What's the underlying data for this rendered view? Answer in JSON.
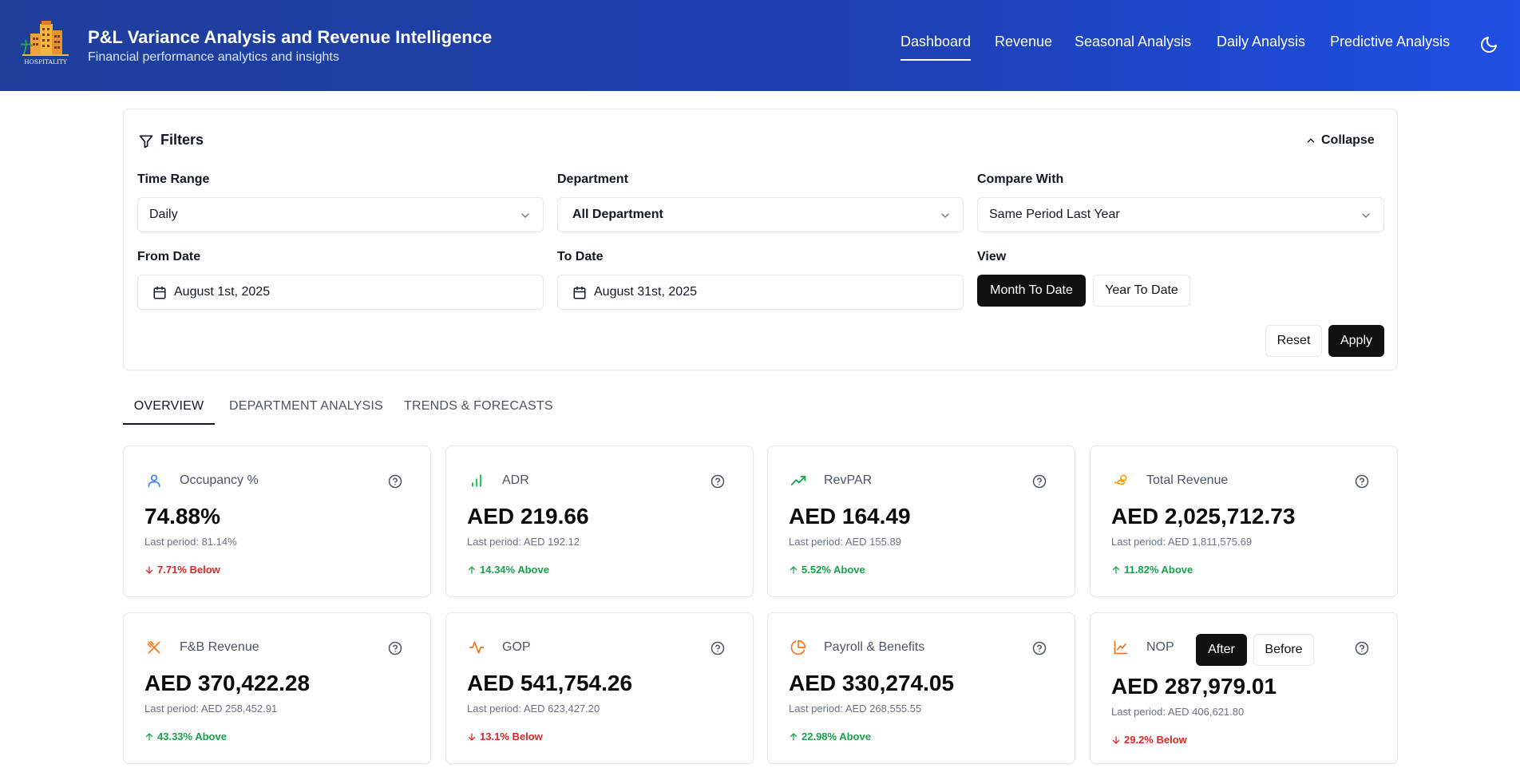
{
  "header": {
    "logo_text": "HOSPITALITY",
    "title": "P&L Variance Analysis and Revenue Intelligence",
    "subtitle": "Financial performance analytics and insights",
    "nav": [
      "Dashboard",
      "Revenue",
      "Seasonal Analysis",
      "Daily Analysis",
      "Predictive Analysis"
    ],
    "active_nav": "Dashboard",
    "theme_icon": "moon-icon"
  },
  "filters": {
    "title": "Filters",
    "collapse_label": "Collapse",
    "time_range_label": "Time Range",
    "time_range_value": "Daily",
    "department_label": "Department",
    "department_value": "All Department",
    "compare_label": "Compare With",
    "compare_value": "Same Period Last Year",
    "from_label": "From Date",
    "from_value": "August 1st, 2025",
    "to_label": "To Date",
    "to_value": "August 31st, 2025",
    "view_label": "View",
    "view_options": [
      "Month To Date",
      "Year To Date"
    ],
    "view_selected": "Month To Date",
    "reset_label": "Reset",
    "apply_label": "Apply"
  },
  "tabs": [
    "OVERVIEW",
    "DEPARTMENT ANALYSIS",
    "TRENDS & FORECASTS"
  ],
  "active_tab": "OVERVIEW",
  "colors": {
    "up": "#16a34a",
    "down": "#dc2626",
    "accent_orange": "#f97316",
    "accent_blue": "#3b82f6"
  },
  "kpis": [
    {
      "label": "Occupancy %",
      "value": "74.88%",
      "last": "Last period: 81.14%",
      "change": "7.71% Below",
      "direction": "down",
      "icon": "user-icon"
    },
    {
      "label": "ADR",
      "value": "AED 219.66",
      "last": "Last period: AED 192.12",
      "change": "14.34% Above",
      "direction": "up",
      "icon": "bar-chart-icon"
    },
    {
      "label": "RevPAR",
      "value": "AED 164.49",
      "last": "Last period: AED 155.89",
      "change": "5.52% Above",
      "direction": "up",
      "icon": "trending-up-icon"
    },
    {
      "label": "Total Revenue",
      "value": "AED 2,025,712.73",
      "last": "Last period: AED 1,811,575.69",
      "change": "11.82% Above",
      "direction": "up",
      "icon": "hand-coins-icon"
    },
    {
      "label": "F&B Revenue",
      "value": "AED 370,422.28",
      "last": "Last period: AED 258,452.91",
      "change": "43.33% Above",
      "direction": "up",
      "icon": "utensils-crossed-icon"
    },
    {
      "label": "GOP",
      "value": "AED 541,754.26",
      "last": "Last period: AED 623,427.20",
      "change": "13.1% Below",
      "direction": "down",
      "icon": "activity-icon"
    },
    {
      "label": "Payroll & Benefits",
      "value": "AED 330,274.05",
      "last": "Last period: AED 268,555.55",
      "change": "22.98% Above",
      "direction": "up",
      "icon": "pie-chart-icon"
    },
    {
      "label": "NOP",
      "value": "AED 287,979.01",
      "last": "Last period: AED 406,621.80",
      "change": "29.2% Below",
      "direction": "down",
      "icon": "line-chart-icon",
      "toggle": [
        "After",
        "Before"
      ],
      "toggle_selected": "After"
    }
  ]
}
